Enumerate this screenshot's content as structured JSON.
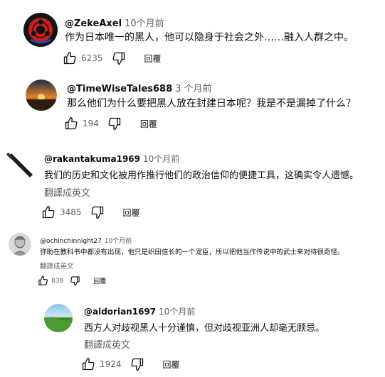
{
  "comments": [
    {
      "author": "@ZekeAxel",
      "time": "10个月前",
      "text": "作为日本唯一的黑人，他可以隐身于社会之外……融入人群之中。",
      "likes": "6235",
      "reply_label": "回覆"
    },
    {
      "author": "@TimeWiseTales688",
      "time": "3 个月前",
      "text": "那么他们为什么要把黑人放在封建日本呢？我是不是漏掉了什么？",
      "likes": "194",
      "reply_label": "回覆"
    },
    {
      "author": "@rakantakuma1969",
      "time": "10个月前",
      "text": "我们的历史和文化被用作推行他们的政治信仰的便捷工具，这确实令人遗憾。",
      "translate": "翻譯成英文",
      "likes": "3485",
      "reply_label": "回覆"
    },
    {
      "author": "@ochinchinnight27",
      "time": "10个月前",
      "text": "弥助在教科书中都没有出现，他只是织田信长的一个宠臣，所以把他当作传说中的武士来对待很奇怪。",
      "translate": "翻譯成英文",
      "likes": "838",
      "reply_label": "回覆"
    },
    {
      "author": "@aidorian1697",
      "time": "10个月前",
      "text": "西方人对歧视黑人十分谨慎，但对歧视亚洲人却毫无顾忌。",
      "translate": "翻譯成英文",
      "likes": "1924",
      "reply_label": "回覆"
    }
  ]
}
